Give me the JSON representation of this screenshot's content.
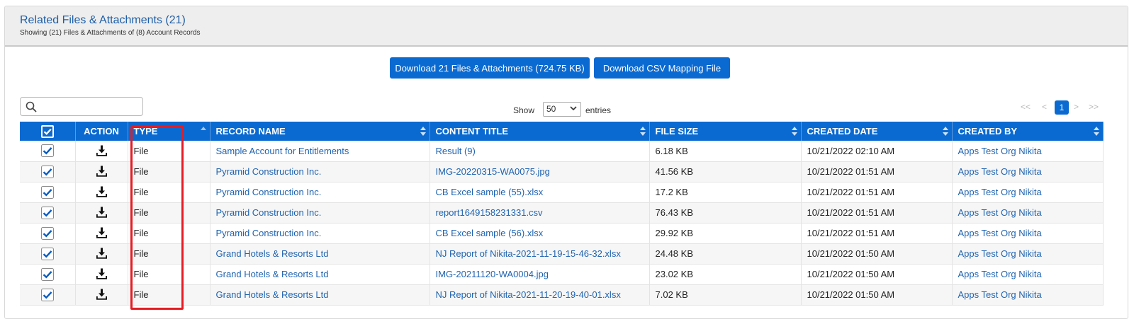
{
  "panel": {
    "title": "Related Files & Attachments (21)",
    "subtitle": "Showing (21) Files & Attachments of (8) Account Records"
  },
  "actions": {
    "download_label": "Download 21 Files & Attachments (724.75 KB)",
    "csv_label": "Download CSV Mapping File"
  },
  "search": {
    "placeholder": ""
  },
  "entries": {
    "show_label": "Show",
    "selected": "50",
    "entries_label": "entries"
  },
  "pagination": {
    "first": "<<",
    "prev": "<",
    "current": "1",
    "next": ">",
    "last": ">>"
  },
  "columns": {
    "action": "ACTION",
    "type": "TYPE",
    "record_name": "RECORD NAME",
    "content_title": "CONTENT TITLE",
    "file_size": "FILE SIZE",
    "created_date": "CREATED DATE",
    "created_by": "CREATED BY"
  },
  "rows": [
    {
      "type": "File",
      "record_name": "Sample Account for Entitlements",
      "content_title": "Result (9)",
      "file_size": "6.18 KB",
      "created_date": "10/21/2022 02:10 AM",
      "created_by": "Apps Test Org Nikita"
    },
    {
      "type": "File",
      "record_name": "Pyramid Construction Inc.",
      "content_title": "IMG-20220315-WA0075.jpg",
      "file_size": "41.56 KB",
      "created_date": "10/21/2022 01:51 AM",
      "created_by": "Apps Test Org Nikita"
    },
    {
      "type": "File",
      "record_name": "Pyramid Construction Inc.",
      "content_title": "CB Excel sample (55).xlsx",
      "file_size": "17.2 KB",
      "created_date": "10/21/2022 01:51 AM",
      "created_by": "Apps Test Org Nikita"
    },
    {
      "type": "File",
      "record_name": "Pyramid Construction Inc.",
      "content_title": "report1649158231331.csv",
      "file_size": "76.43 KB",
      "created_date": "10/21/2022 01:51 AM",
      "created_by": "Apps Test Org Nikita"
    },
    {
      "type": "File",
      "record_name": "Pyramid Construction Inc.",
      "content_title": "CB Excel sample (56).xlsx",
      "file_size": "29.92 KB",
      "created_date": "10/21/2022 01:51 AM",
      "created_by": "Apps Test Org Nikita"
    },
    {
      "type": "File",
      "record_name": "Grand Hotels & Resorts Ltd",
      "content_title": "NJ Report of Nikita-2021-11-19-15-46-32.xlsx",
      "file_size": "24.48 KB",
      "created_date": "10/21/2022 01:50 AM",
      "created_by": "Apps Test Org Nikita"
    },
    {
      "type": "File",
      "record_name": "Grand Hotels & Resorts Ltd",
      "content_title": "IMG-20211120-WA0004.jpg",
      "file_size": "23.02 KB",
      "created_date": "10/21/2022 01:50 AM",
      "created_by": "Apps Test Org Nikita"
    },
    {
      "type": "File",
      "record_name": "Grand Hotels & Resorts Ltd",
      "content_title": "NJ Report of Nikita-2021-11-20-19-40-01.xlsx",
      "file_size": "7.02 KB",
      "created_date": "10/21/2022 01:50 AM",
      "created_by": "Apps Test Org Nikita"
    }
  ],
  "colors": {
    "accent": "#0a6ad1",
    "link": "#1f63b0",
    "highlight": "#e51c23"
  }
}
